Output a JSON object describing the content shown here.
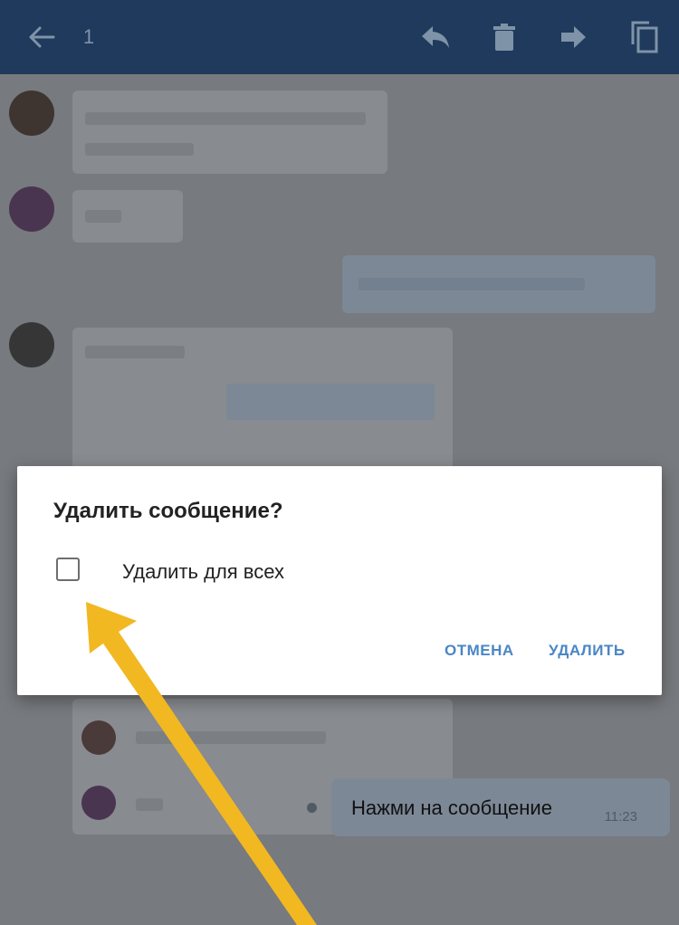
{
  "toolbar": {
    "selected_count": "1",
    "icons": [
      "back-arrow-icon",
      "reply-icon",
      "trash-icon",
      "forward-icon",
      "copy-icon"
    ]
  },
  "dialog": {
    "title": "Удалить сообщение?",
    "checkbox_label": "Удалить для всех",
    "checkbox_checked": false,
    "cancel_label": "ОТМЕНА",
    "delete_label": "УДАЛИТЬ"
  },
  "last_message": {
    "text": "Нажми на сообщение",
    "time": "11:23"
  },
  "colors": {
    "toolbar": "#1f3a5c",
    "dim_overlay": "#777a7e",
    "dialog_button": "#4b86c4",
    "annotation_arrow": "#f2b822"
  }
}
